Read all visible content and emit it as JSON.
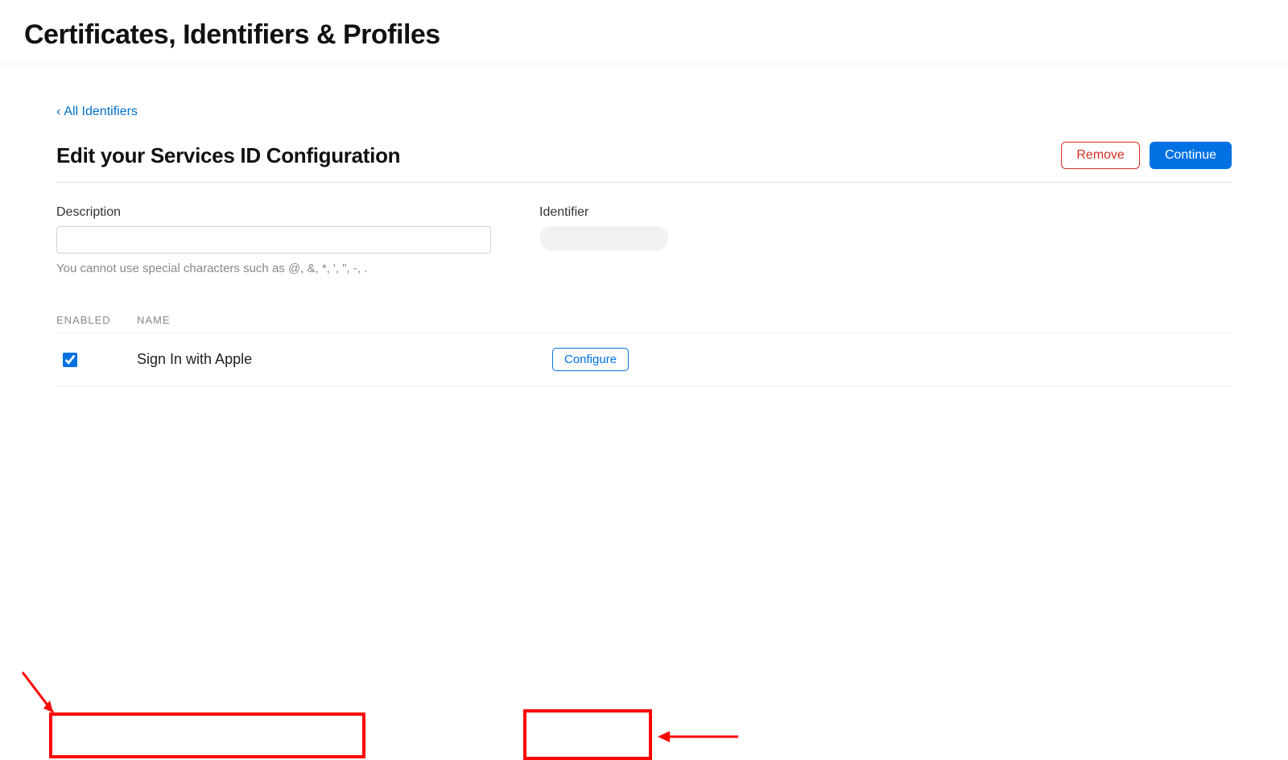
{
  "header": {
    "title": "Certificates, Identifiers & Profiles"
  },
  "breadcrumb": {
    "chev": "‹",
    "label": "All Identifiers"
  },
  "subheader": {
    "title": "Edit your Services ID Configuration",
    "buttons": {
      "remove": "Remove",
      "continue": "Continue"
    }
  },
  "form": {
    "description_label": "Description",
    "description_value": "",
    "identifier_label": "Identifier",
    "help_text": "You cannot use special characters such as @, &, *, ', \", -, ."
  },
  "capabilities": {
    "col_enabled": "ENABLED",
    "col_name": "NAME",
    "rows": [
      {
        "checked": true,
        "name": "Sign In with Apple",
        "configure_label": "Configure"
      }
    ]
  }
}
